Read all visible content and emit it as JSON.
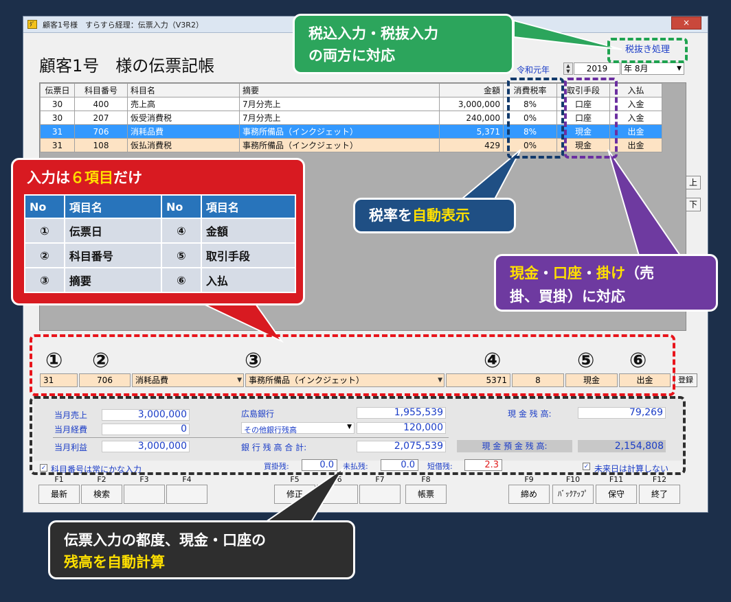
{
  "window": {
    "title": "顧客1号様　すらすら経理：伝票入力（V3R2）",
    "close": "×",
    "app_icon": "ﾀﾞ"
  },
  "page": {
    "title": "顧客1号　様の伝票記帳",
    "tax_exclusive_button": "税抜き処理",
    "era_label": "令和元年",
    "year_value": "2019",
    "year_unit": "年",
    "month_value": "8月"
  },
  "grid": {
    "headers": [
      "伝票日",
      "科目番号",
      "科目名",
      "摘要",
      "金額",
      "消費税率",
      "取引手段",
      "入払"
    ],
    "rows": [
      [
        "30",
        "400",
        "売上高",
        "7月分売上",
        "3,000,000",
        "8%",
        "口座",
        "入金"
      ],
      [
        "30",
        "207",
        "仮受消費税",
        "7月分売上",
        "240,000",
        "0%",
        "口座",
        "入金"
      ],
      [
        "31",
        "706",
        "消耗品費",
        "事務所備品（インクジェット）",
        "5,371",
        "8%",
        "現金",
        "出金"
      ],
      [
        "31",
        "108",
        "仮払消費税",
        "事務所備品（インクジェット）",
        "429",
        "0%",
        "現金",
        "出金"
      ]
    ],
    "up_button": "上",
    "down_button": "下"
  },
  "entry": {
    "numbers": [
      "①",
      "②",
      "③",
      "④",
      "⑤",
      "⑥"
    ],
    "day": "31",
    "account_no": "706",
    "account_name": "消耗品費",
    "memo": "事務所備品（インクジェット）",
    "amount": "5371",
    "tax_rate": "8",
    "method": "現金",
    "in_out": "出金",
    "register_button": "登録"
  },
  "summary": {
    "monthly_sales_label": "当月売上",
    "monthly_sales": "3,000,000",
    "monthly_expense_label": "当月経費",
    "monthly_expense": "0",
    "monthly_profit_label": "当月利益",
    "monthly_profit": "3,000,000",
    "bank_name": "広島銀行",
    "bank_value": "1,955,539",
    "other_bank_label": "その他銀行残高",
    "other_bank_value": "120,000",
    "bank_total_label": "銀 行 残 高 合 計:",
    "bank_total": "2,075,539",
    "cash_label": "現 金 残 高:",
    "cash_value": "79,269",
    "cash_deposit_label": "現 金 預 金 残 高:",
    "cash_deposit_value": "2,154,808",
    "kana_checkbox": "科目番号は常にかな入力",
    "payable_label": "買掛残:",
    "payable_value": "0.0",
    "receivable_label": "未払残:",
    "receivable_value": "0.0",
    "short_loan_label": "短借残:",
    "short_loan_value": "2.3",
    "future_checkbox": "未来日は計算しない",
    "check_mark": "✓"
  },
  "fkeys": {
    "labels": [
      "F1",
      "F2",
      "F3",
      "F4",
      "F5",
      "F6",
      "F7",
      "F8",
      "F9",
      "F10",
      "F11",
      "F12"
    ],
    "buttons": [
      "最新",
      "検索",
      "",
      "",
      "修正",
      "",
      "",
      "帳票",
      "締め",
      "ﾊﾞｯｸｱｯﾌﾟ",
      "保守",
      "終了"
    ]
  },
  "callouts": {
    "green_line1": "税込入力・税抜入力",
    "green_line2": "の両方に対応",
    "blue_prefix": "税率を",
    "blue_highlight": "自動表示",
    "purple_hl1": "現金",
    "purple_sep1": "・",
    "purple_hl2": "口座",
    "purple_sep2": "・",
    "purple_hl3": "掛け",
    "purple_line1_rest": "（売",
    "purple_line2": "掛、買掛）に対応",
    "red_prefix": "入力は",
    "red_highlight": "６項目",
    "red_suffix": "だけ",
    "dark_line1": "伝票入力の都度、現金・口座の",
    "dark_highlight": "残高を自動計算"
  },
  "items_table": {
    "headers": [
      "No",
      "項目名",
      "No",
      "項目名"
    ],
    "rows": [
      [
        "①",
        "伝票日",
        "④",
        "金額"
      ],
      [
        "②",
        "科目番号",
        "⑤",
        "取引手段"
      ],
      [
        "③",
        "摘要",
        "⑥",
        "入払"
      ]
    ]
  },
  "colors": {
    "background": "#1c2f4a",
    "green": "#2ca55c",
    "blue": "#1f4f84",
    "purple": "#6e3aa0",
    "red": "#d81a21",
    "dark": "#2e2e2e",
    "selected_row": "#3399ff",
    "entry_row": "#fde3c4"
  }
}
